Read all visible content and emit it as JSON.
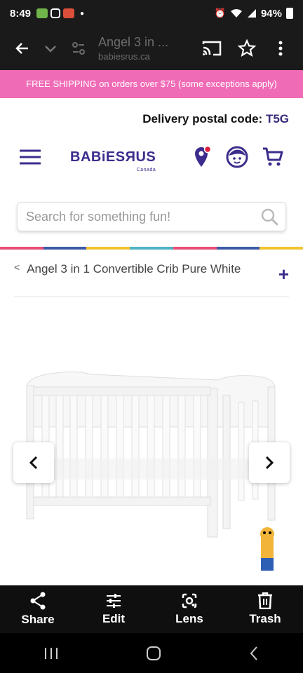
{
  "status_bar": {
    "time": "8:49",
    "battery": "94%"
  },
  "browser": {
    "tab_title": "Angel 3 in ...",
    "url": "babiesrus.ca"
  },
  "site": {
    "promo": "FREE SHIPPING on orders over $75 (some exceptions apply)",
    "postal_label": "Delivery postal code:",
    "postal_code": "T5G",
    "logo_main": "BABiESЯUS",
    "logo_sub": "Canada",
    "search_placeholder": "Search for something fun!",
    "breadcrumb_back": "<",
    "product_title": "Angel 3 in 1 Convertible Crib Pure White",
    "expand": "+"
  },
  "rainbow_colors": [
    "#e94e77",
    "#3d5ba9",
    "#f2c230",
    "#4fb3c5",
    "#e94e77",
    "#3d5ba9",
    "#f2c230"
  ],
  "actions": [
    {
      "label": "Share",
      "icon": "share-icon"
    },
    {
      "label": "Edit",
      "icon": "sliders-icon"
    },
    {
      "label": "Lens",
      "icon": "lens-icon"
    },
    {
      "label": "Trash",
      "icon": "trash-icon"
    }
  ],
  "colors": {
    "brand": "#3d2c8d",
    "promo": "#f06bb6"
  }
}
